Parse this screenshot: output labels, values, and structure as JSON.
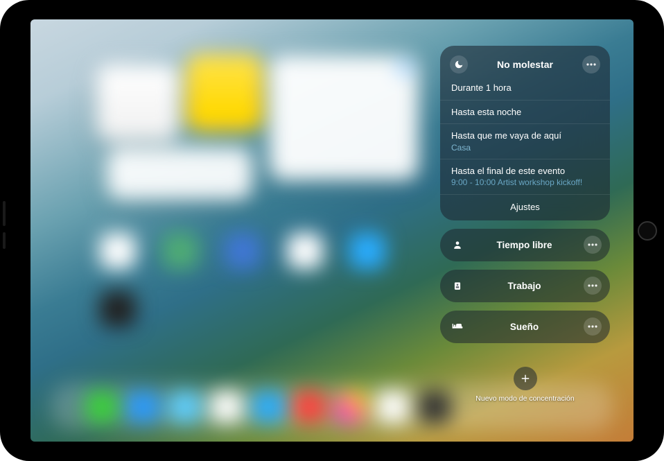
{
  "focus_panel": {
    "dnd": {
      "title": "No molestar",
      "options": {
        "one_hour": "Durante 1 hora",
        "until_tonight": "Hasta esta noche",
        "until_leave": "Hasta que me vaya de aquí",
        "until_leave_place": "Casa",
        "until_event_end": "Hasta el final de este evento",
        "event_detail": "9:00 - 10:00 Artist workshop kickoff!"
      },
      "settings": "Ajustes"
    },
    "modes": {
      "personal": "Tiempo libre",
      "work": "Trabajo",
      "sleep": "Sueño"
    },
    "add_new": "Nuevo modo de concentración"
  }
}
